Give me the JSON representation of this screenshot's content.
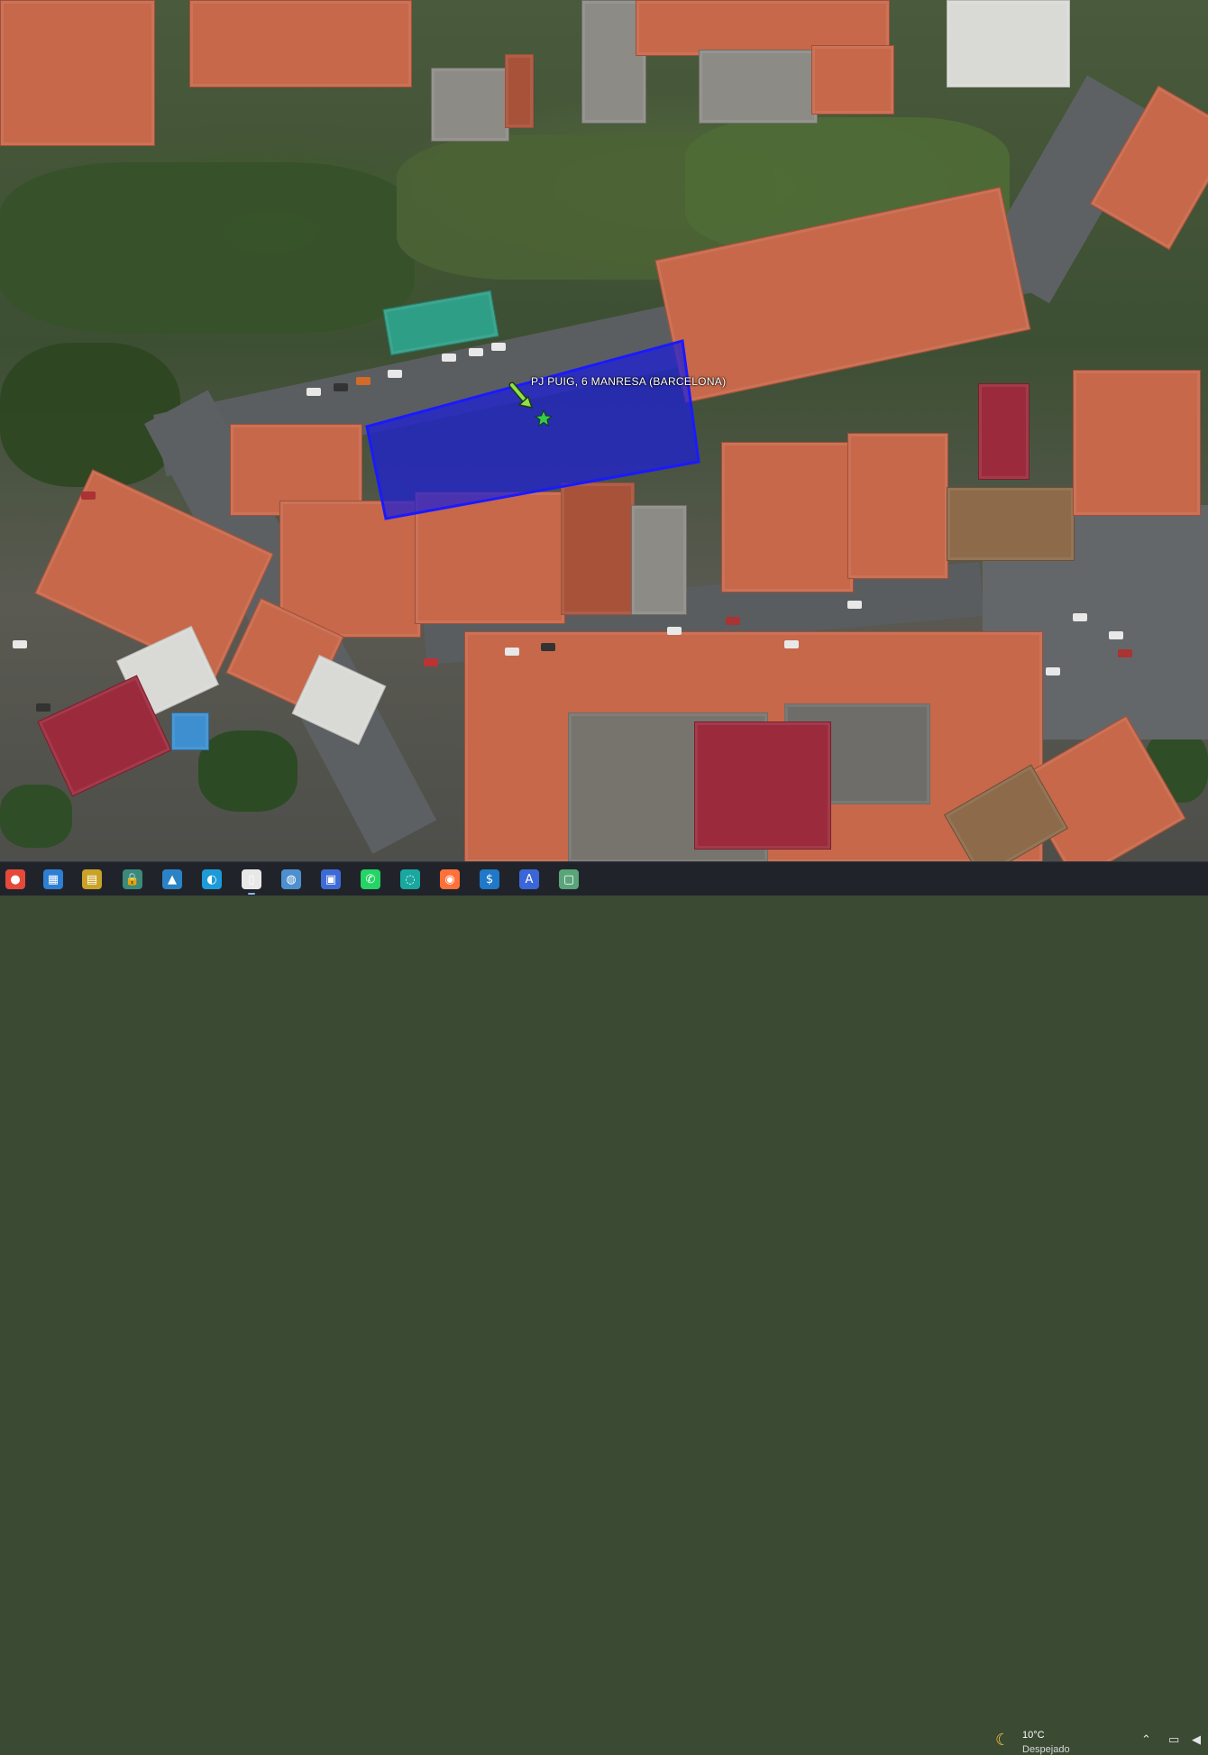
{
  "map": {
    "placemark_label": "PJ PUIG, 6  MANRESA (BARCELONA)",
    "parcel_fill_color": "#1c1fd8",
    "parcel_border_color": "#1a1aff",
    "placemark_icon": "green-star-icon",
    "pointer_icon": "green-arrow-icon"
  },
  "taskbar": {
    "apps": [
      {
        "name": "chrome",
        "icon": "chrome-icon",
        "glyph": "●",
        "color": "#e5493a"
      },
      {
        "name": "maps",
        "icon": "maps-icon",
        "glyph": "▦",
        "color": "#2d7fd3"
      },
      {
        "name": "folder-gallery",
        "icon": "gallery-icon",
        "glyph": "▤",
        "color": "#c9a227"
      },
      {
        "name": "lock-folder",
        "icon": "lock-icon",
        "glyph": "🔒",
        "color": "#3b8a7a"
      },
      {
        "name": "photos",
        "icon": "photos-icon",
        "glyph": "▲",
        "color": "#2b83c6"
      },
      {
        "name": "edge",
        "icon": "edge-icon",
        "glyph": "◐",
        "color": "#1d9bd8"
      },
      {
        "name": "document",
        "icon": "document-icon",
        "glyph": "▯",
        "color": "#e8e8e8"
      },
      {
        "name": "earth",
        "icon": "globe-icon",
        "glyph": "◍",
        "color": "#4d8fcf"
      },
      {
        "name": "save",
        "icon": "floppy-icon",
        "glyph": "▣",
        "color": "#3d6ad6"
      },
      {
        "name": "whatsapp",
        "icon": "whatsapp-icon",
        "glyph": "✆",
        "color": "#25d366"
      },
      {
        "name": "wifi-app",
        "icon": "wave-icon",
        "glyph": "◌",
        "color": "#19a7a0"
      },
      {
        "name": "firefox",
        "icon": "firefox-icon",
        "glyph": "◉",
        "color": "#ff7139"
      },
      {
        "name": "dollar-app",
        "icon": "dollar-icon",
        "glyph": "$",
        "color": "#1f78c8"
      },
      {
        "name": "arc-app",
        "icon": "arc-icon",
        "glyph": "A",
        "color": "#3a66d8"
      },
      {
        "name": "window-app",
        "icon": "window-icon",
        "glyph": "▢",
        "color": "#5aa47a"
      }
    ],
    "weather": {
      "icon": "moon-icon",
      "temperature": "10°C",
      "description": "Despejado"
    },
    "tray": {
      "chevron_icon": "chevron-up-icon",
      "monitor_icon": "monitor-icon",
      "speaker_icon": "speaker-icon"
    }
  }
}
